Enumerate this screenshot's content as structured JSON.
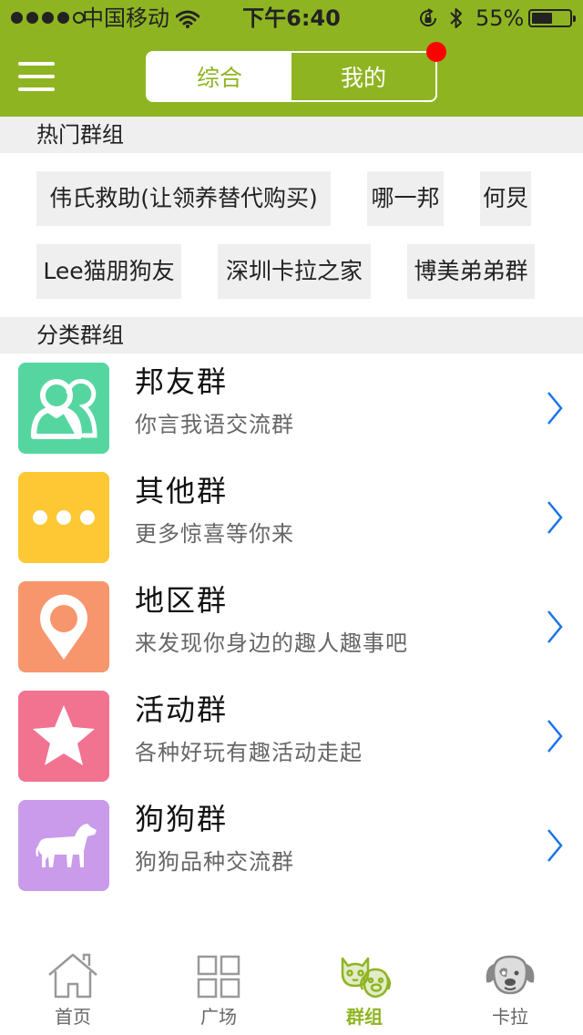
{
  "colors": {
    "accent": "#8fb422",
    "badge": "#ff0000",
    "chevron": "#1a73e8"
  },
  "status_bar": {
    "carrier": "中国移动",
    "time": "下午6:40",
    "battery_percent": 55,
    "battery_text": "55%",
    "icons": [
      "signal-dots-icon",
      "wifi-icon",
      "rotation-lock-icon",
      "bluetooth-icon",
      "battery-icon"
    ]
  },
  "header": {
    "menu_icon": "hamburger-menu-icon",
    "segments": [
      "综合",
      "我的"
    ],
    "selected_segment": "综合",
    "has_notification_badge": true
  },
  "hot_groups": {
    "title": "热门群组",
    "items": [
      "伟氏救助(让领养替代购买)",
      "哪一邦",
      "何炅",
      "Lee猫朋狗友",
      "深圳卡拉之家",
      "博美弟弟群"
    ]
  },
  "categories": {
    "title": "分类群组",
    "items": [
      {
        "title": "邦友群",
        "subtitle": "你言我语交流群",
        "icon": "friends-icon",
        "color": "#55d6a0"
      },
      {
        "title": "其他群",
        "subtitle": "更多惊喜等你来",
        "icon": "more-dots-icon",
        "color": "#fdc833"
      },
      {
        "title": "地区群",
        "subtitle": "来发现你身边的趣人趣事吧",
        "icon": "location-pin-icon",
        "color": "#f7956c"
      },
      {
        "title": "活动群",
        "subtitle": "各种好玩有趣活动走起",
        "icon": "star-icon",
        "color": "#f17390"
      },
      {
        "title": "狗狗群",
        "subtitle": "狗狗品种交流群",
        "icon": "dog-icon",
        "color": "#c99bea"
      }
    ]
  },
  "tab_bar": {
    "items": [
      {
        "label": "首页",
        "icon": "home-icon"
      },
      {
        "label": "广场",
        "icon": "grid-icon"
      },
      {
        "label": "群组",
        "icon": "cat-dog-icon"
      },
      {
        "label": "卡拉",
        "icon": "dog-face-icon"
      }
    ],
    "active": "群组"
  }
}
